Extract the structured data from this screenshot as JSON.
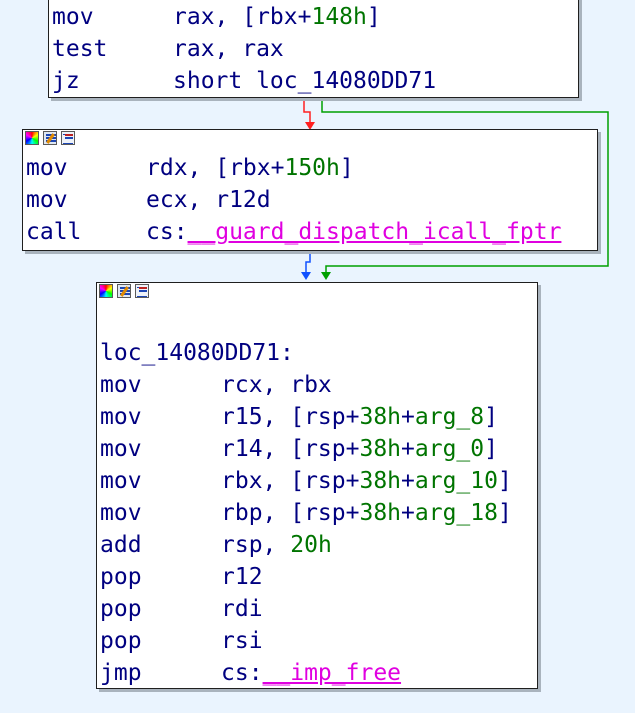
{
  "blocks": {
    "b1": {
      "lines": [
        {
          "mnemonic": "mov",
          "parts": [
            {
              "t": "rax, [rbx+"
            },
            {
              "t": "148h",
              "c": "num"
            },
            {
              "t": "]"
            }
          ]
        },
        {
          "mnemonic": "test",
          "parts": [
            {
              "t": "rax, rax"
            }
          ]
        },
        {
          "mnemonic": "jz",
          "parts": [
            {
              "t": "short loc_14080DD71"
            }
          ]
        }
      ]
    },
    "b2": {
      "lines": [
        {
          "mnemonic": "mov",
          "parts": [
            {
              "t": "rdx, [rbx+"
            },
            {
              "t": "150h",
              "c": "num"
            },
            {
              "t": "]"
            }
          ]
        },
        {
          "mnemonic": "mov",
          "parts": [
            {
              "t": "ecx, r12d"
            }
          ]
        },
        {
          "mnemonic": "call",
          "parts": [
            {
              "t": "cs:"
            },
            {
              "t": "__guard_dispatch_icall_fptr",
              "c": "ext"
            }
          ]
        }
      ]
    },
    "b3": {
      "label": "loc_14080DD71:",
      "lines": [
        {
          "mnemonic": "mov",
          "parts": [
            {
              "t": "rcx, rbx"
            }
          ]
        },
        {
          "mnemonic": "mov",
          "parts": [
            {
              "t": "r15, [rsp+"
            },
            {
              "t": "38h",
              "c": "num"
            },
            {
              "t": "+"
            },
            {
              "t": "arg_8",
              "c": "arg"
            },
            {
              "t": "]"
            }
          ]
        },
        {
          "mnemonic": "mov",
          "parts": [
            {
              "t": "r14, [rsp+"
            },
            {
              "t": "38h",
              "c": "num"
            },
            {
              "t": "+"
            },
            {
              "t": "arg_0",
              "c": "arg"
            },
            {
              "t": "]"
            }
          ]
        },
        {
          "mnemonic": "mov",
          "parts": [
            {
              "t": "rbx, [rsp+"
            },
            {
              "t": "38h",
              "c": "num"
            },
            {
              "t": "+"
            },
            {
              "t": "arg_10",
              "c": "arg"
            },
            {
              "t": "]"
            }
          ]
        },
        {
          "mnemonic": "mov",
          "parts": [
            {
              "t": "rbp, [rsp+"
            },
            {
              "t": "38h",
              "c": "num"
            },
            {
              "t": "+"
            },
            {
              "t": "arg_18",
              "c": "arg"
            },
            {
              "t": "]"
            }
          ]
        },
        {
          "mnemonic": "add",
          "parts": [
            {
              "t": "rsp, "
            },
            {
              "t": "20h",
              "c": "num"
            }
          ]
        },
        {
          "mnemonic": "pop",
          "parts": [
            {
              "t": "r12"
            }
          ]
        },
        {
          "mnemonic": "pop",
          "parts": [
            {
              "t": "rdi"
            }
          ]
        },
        {
          "mnemonic": "pop",
          "parts": [
            {
              "t": "rsi"
            }
          ]
        },
        {
          "mnemonic": "jmp",
          "parts": [
            {
              "t": "cs:"
            },
            {
              "t": "__imp_free",
              "c": "ext"
            }
          ]
        }
      ]
    }
  },
  "colors": {
    "background": "#eaf4fe",
    "text": "#000080",
    "number": "#007400",
    "external": "#e000e0",
    "edge_true": "#00a000",
    "edge_false": "#ff0000",
    "edge_flow": "#0050ff"
  },
  "titlebar_icons": [
    "palette-icon",
    "edit-icon",
    "graph-icon"
  ]
}
